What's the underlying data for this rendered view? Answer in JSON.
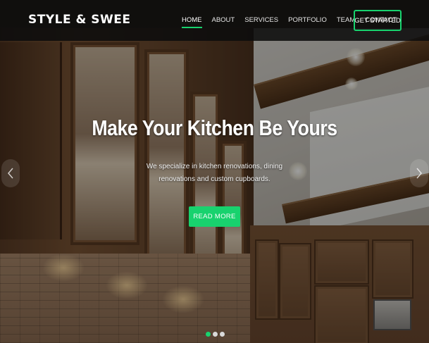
{
  "header": {
    "brand": "STYLE & SWEE",
    "nav": [
      {
        "label": "HOME",
        "active": true
      },
      {
        "label": "ABOUT",
        "active": false
      },
      {
        "label": "SERVICES",
        "active": false
      },
      {
        "label": "PORTFOLIO",
        "active": false
      },
      {
        "label": "TEAM",
        "active": false
      },
      {
        "label": "CONTACT",
        "active": false
      }
    ],
    "cta_label": "GET STARTED"
  },
  "hero": {
    "title": "Make Your Kitchen Be Yours",
    "subtitle": "We specialize in kitchen renovations, dining renovations and custom cupboards.",
    "button_label": "READ MORE"
  },
  "carousel": {
    "prev_icon": "chevron-left-icon",
    "next_icon": "chevron-right-icon",
    "slide_count": 3,
    "active_slide": 1
  },
  "colors": {
    "accent": "#18d26e",
    "header_bg": "#0c0c0c",
    "text": "#ffffff"
  }
}
